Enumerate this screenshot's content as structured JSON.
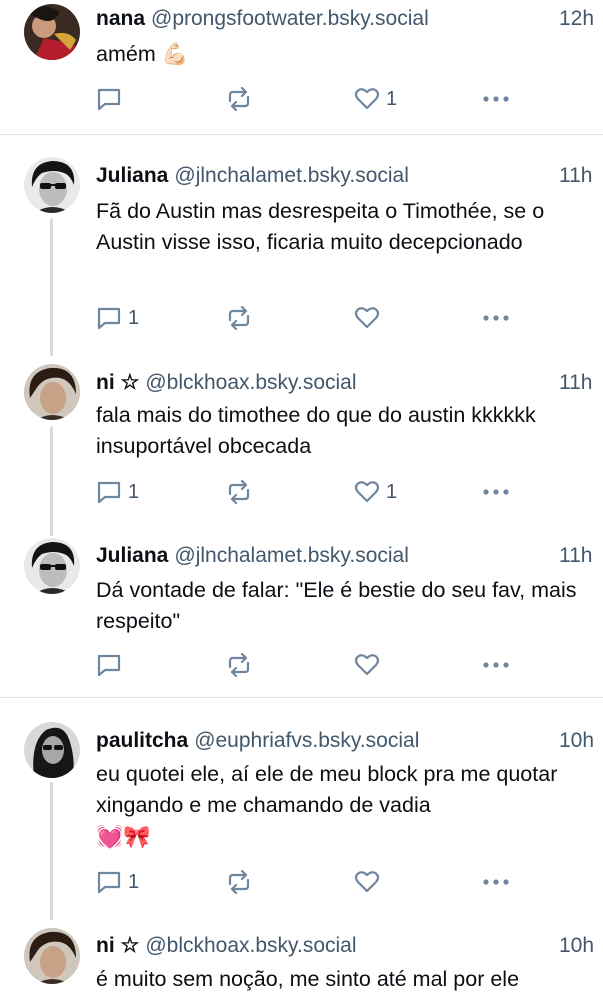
{
  "posts": [
    {
      "name": "nana",
      "handle": "@prongsfootwater.bsky.social",
      "time": "12h",
      "text": "amém 💪🏻",
      "replies": "",
      "likes": "1"
    },
    {
      "name": "Juliana",
      "handle": "@jlnchalamet.bsky.social",
      "time": "11h",
      "text": "Fã do Austin mas desrespeita o Timothée, se o Austin visse isso, ficaria muito decepcionado",
      "replies": "1",
      "likes": ""
    },
    {
      "name": "ni ☆",
      "handle": "@blckhoax.bsky.social",
      "time": "11h",
      "text": "fala mais do timothee do que do austin kkkkkk insuportável obcecada",
      "replies": "1",
      "likes": "1"
    },
    {
      "name": "Juliana",
      "handle": "@jlnchalamet.bsky.social",
      "time": "11h",
      "text": "Dá vontade de falar: \"Ele é bestie do seu fav, mais respeito\"",
      "replies": "",
      "likes": ""
    },
    {
      "name": "paulitcha",
      "handle": "@euphriafvs.bsky.social",
      "time": "10h",
      "text": "eu quotei ele, aí ele de meu block pra me quotar xingando e me chamando de vadia",
      "emoji": "💓🎀",
      "replies": "1",
      "likes": ""
    },
    {
      "name": "ni ☆",
      "handle": "@blckhoax.bsky.social",
      "time": "10h",
      "text": "é muito sem noção, me sinto até mal por ele",
      "replies": "",
      "likes": ""
    }
  ],
  "icons": {
    "reply": "reply-icon",
    "repost": "repost-icon",
    "like": "heart-icon",
    "more": "more-icon"
  },
  "colors": {
    "text": "#0b0f14",
    "muted": "#42576c",
    "icon": "#6f869f",
    "thread_line": "#d4dbe2"
  }
}
